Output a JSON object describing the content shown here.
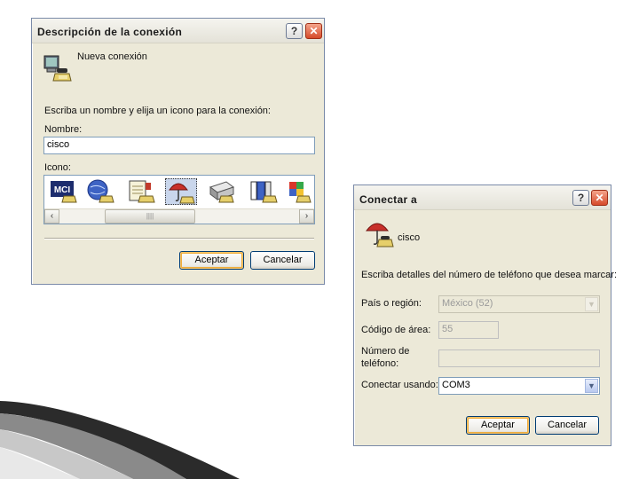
{
  "dialog_new_connection": {
    "title": "Descripción de la conexión",
    "help_button": "?",
    "close_button": "✕",
    "header_text": "Nueva conexión",
    "instruction": "Escriba un nombre y elija un icono para la conexión:",
    "name_label": "Nombre:",
    "name_value": "cisco",
    "icon_label": "Icono:",
    "icons": [
      "mci-icon",
      "globe-phone-icon",
      "notepad-phone-icon",
      "umbrella-phone-icon",
      "phone-device-icon",
      "books-phone-icon",
      "colorful-phone-icon"
    ],
    "selected_icon_index": 3,
    "icon_mci_text": "MCI",
    "scroll_left": "‹",
    "scroll_right": "›",
    "scroll_grip": "||||",
    "ok_button": "Aceptar",
    "cancel_button": "Cancelar"
  },
  "dialog_connect_to": {
    "title": "Conectar a",
    "help_button": "?",
    "close_button": "✕",
    "connection_name": "cisco",
    "instruction": "Escriba detalles del número de teléfono que desea marcar:",
    "country_label": "País o región:",
    "country_value": "México (52)",
    "area_code_label": "Código de área:",
    "area_code_value": "55",
    "phone_label_line1": "Número de",
    "phone_label_line2": "teléfono:",
    "phone_value": "",
    "connect_using_label": "Conectar usando:",
    "connect_using_value": "COM3",
    "ok_button": "Aceptar",
    "cancel_button": "Cancelar"
  },
  "colors": {
    "dialog_background": "#ece9d8",
    "border_blue": "#7f9db9",
    "close_red": "#d64a2a",
    "default_button_glow": "#f0ad3c"
  }
}
